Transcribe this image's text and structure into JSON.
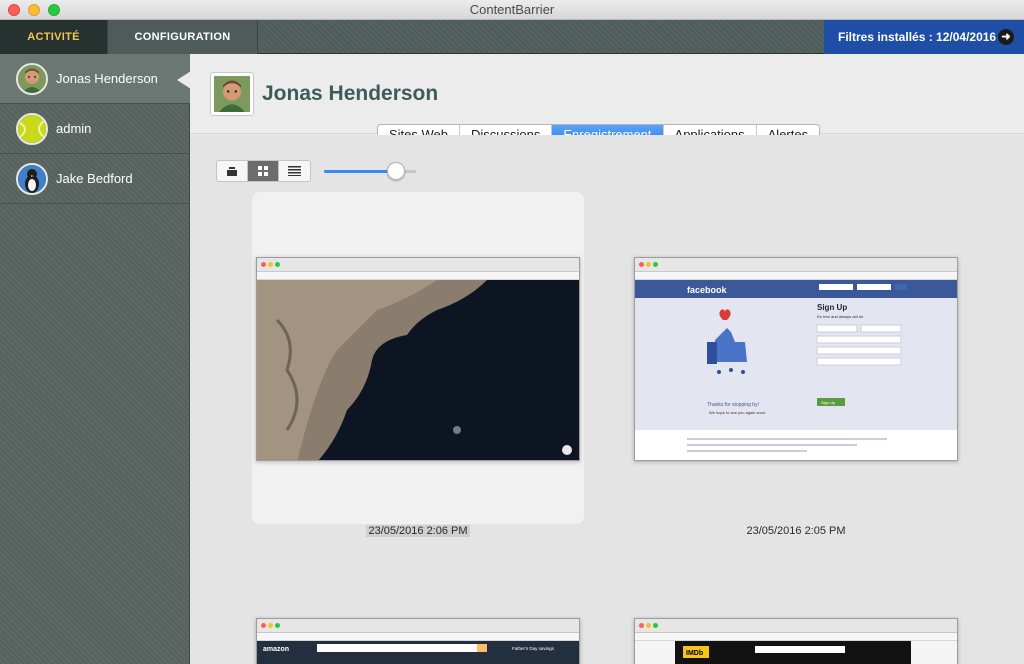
{
  "window": {
    "title": "ContentBarrier"
  },
  "nav": {
    "activity_tab": "ACTIVITÉ",
    "config_tab": "CONFIGURATION",
    "filters_label": "Filtres installés : 12/04/2016",
    "filters_icon": "arrow-right-icon"
  },
  "sidebar": {
    "users": [
      {
        "name": "Jonas Henderson",
        "avatar": "person-avatar",
        "selected": true
      },
      {
        "name": "admin",
        "avatar": "tennis-ball-avatar",
        "selected": false
      },
      {
        "name": "Jake Bedford",
        "avatar": "penguin-avatar",
        "selected": false
      }
    ]
  },
  "main": {
    "user_title": "Jonas Henderson",
    "tabs": [
      "Sites Web",
      "Discussions",
      "Enregistrement",
      "Applications",
      "Alertes"
    ],
    "active_tab": "Enregistrement",
    "view_modes": [
      "cover-flow-icon",
      "grid-icon",
      "list-icon"
    ],
    "active_view": "grid-icon",
    "zoom_level": 0.78,
    "screenshots": [
      {
        "timestamp": "23/05/2016 2:06 PM",
        "site": "satellite-map",
        "selected": true
      },
      {
        "timestamp": "23/05/2016 2:05 PM",
        "site": "facebook",
        "selected": false
      },
      {
        "timestamp": "",
        "site": "amazon",
        "selected": false
      },
      {
        "timestamp": "",
        "site": "imdb",
        "selected": false
      }
    ],
    "facebook_thumb": {
      "logo": "facebook",
      "signup": "Sign Up",
      "tagline": "It's free and always will be.",
      "thanks": "Thanks for stopping by!",
      "hope": "We hope to see you again soon.",
      "button": "Sign Up"
    },
    "amazon_thumb": {
      "logo": "amazon",
      "promo": "Father's Day savings"
    },
    "imdb_thumb": {
      "logo": "IMDb"
    }
  },
  "colors": {
    "accent": "#2f80ec",
    "activity_tab_text": "#f3c550",
    "filters_bg": "#1e4ea6",
    "title": "#3e5b5b"
  }
}
